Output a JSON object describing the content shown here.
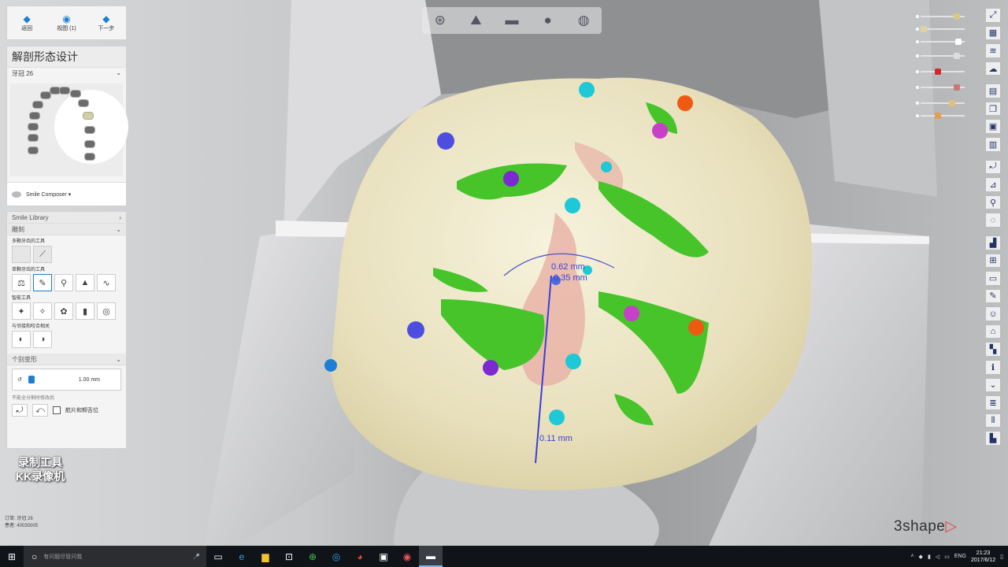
{
  "app": {
    "brand": "3shape",
    "brand_mark": "▷"
  },
  "nav": {
    "back": "返回",
    "view": "视图 (1)",
    "next": "下一步"
  },
  "design": {
    "title": "解剖形态设计",
    "tooth": "牙冠 26",
    "composer_label": "Smile Composer ▾"
  },
  "tools": {
    "library_label": "Smile Library",
    "section_label": "雕刻",
    "multi_label": "多颗牙齿的工具",
    "single_label": "单颗牙齿的工具",
    "smart_label": "智能工具",
    "contact_label": "与邻接和咬合相关",
    "thickness_header": "个别变形",
    "thickness_value": "1.00 mm",
    "hint": "不能全分割时修改后",
    "checkbox_label": "航片和颊舌位"
  },
  "measurements": {
    "m1": "0.62 mm",
    "m2": "0.35 mm",
    "m3": "0.11 mm"
  },
  "watermark": {
    "line1": "录制工具",
    "line2": "KK录像机"
  },
  "order": {
    "line1": "订单: 牙冠 26",
    "line2": "患者: 40030005"
  },
  "taskbar": {
    "search_placeholder": "有问题尽管问我",
    "lang": "ENG",
    "time": "21:23",
    "date": "2017/6/12"
  },
  "colors": {
    "accent": "#1e7fd2",
    "tooth": "#ede6c6",
    "contact_green": "#3fc81f",
    "contact_pink": "#e9a79e"
  }
}
